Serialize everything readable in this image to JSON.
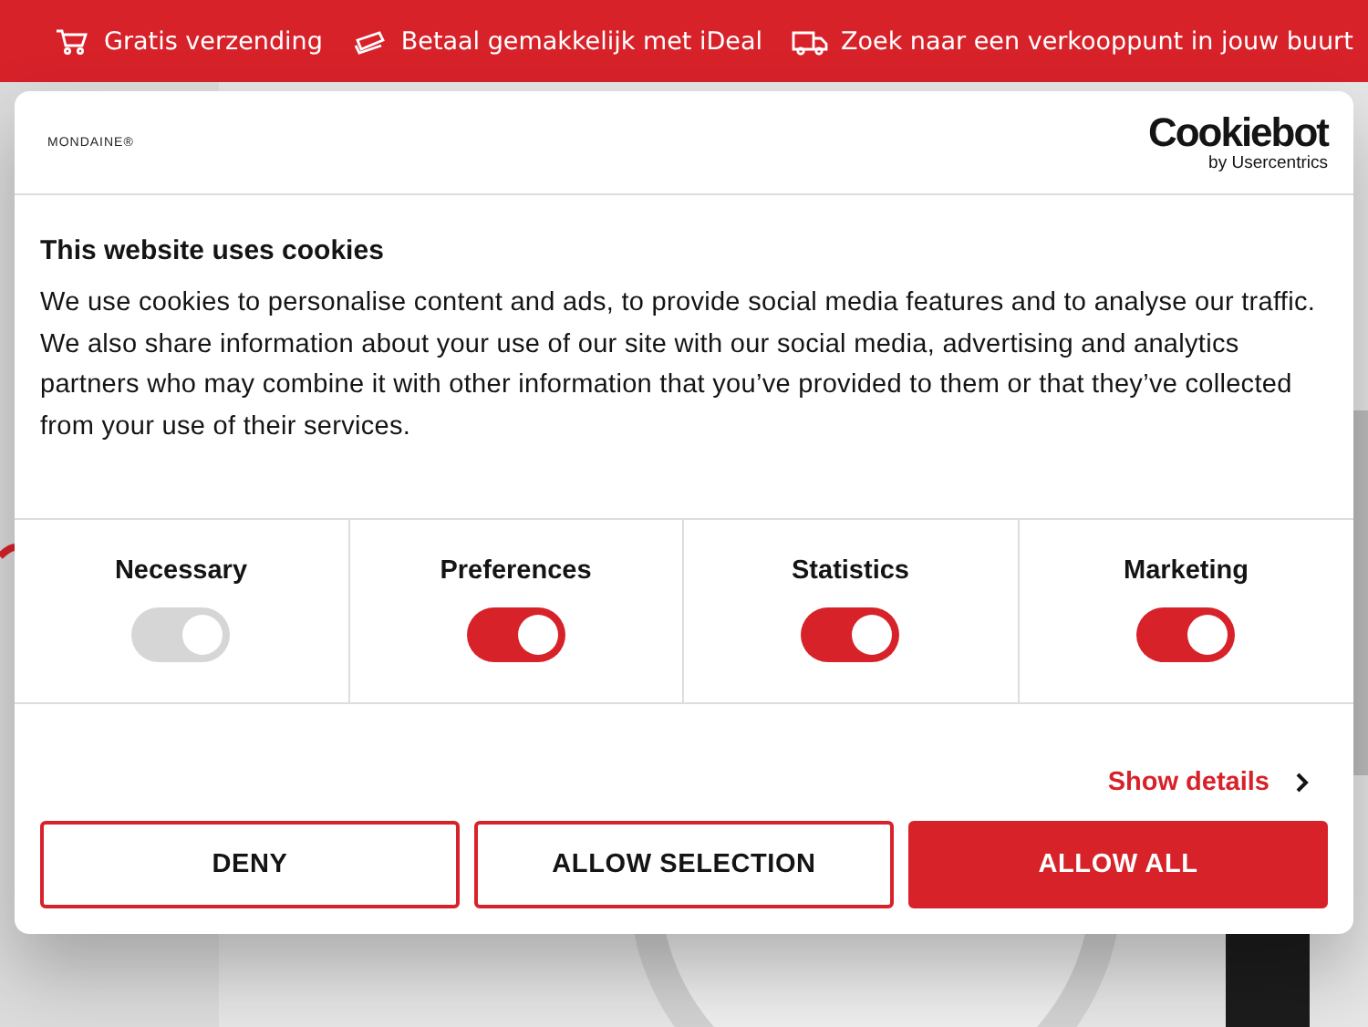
{
  "promo_bar": [
    {
      "kind": "cart",
      "text": "Gratis verzending"
    },
    {
      "kind": "money",
      "text": "Betaal gemakkelijk met iDeal"
    },
    {
      "kind": "truck",
      "text": "Zoek naar een verkooppunt in jouw buurt"
    }
  ],
  "dialog": {
    "brand_logo": "MONDAINE®",
    "provider_logo": {
      "name": "Cookiebot",
      "byline": "by Usercentrics"
    },
    "title": "This website uses cookies",
    "body": "We use cookies to personalise content and ads, to provide social media features and to analyse our traffic. We also share information about your use of our site with our social media, advertising and analytics partners who may combine it with other information that you’ve provided to them or that they’ve collected from your use of their services.",
    "categories": [
      {
        "label": "Necessary",
        "checked": true,
        "disabled": true
      },
      {
        "label": "Preferences",
        "checked": true,
        "disabled": false
      },
      {
        "label": "Statistics",
        "checked": true,
        "disabled": false
      },
      {
        "label": "Marketing",
        "checked": true,
        "disabled": false
      }
    ],
    "details_link": "Show details",
    "buttons": [
      {
        "label": "DENY",
        "kind": "outline"
      },
      {
        "label": "ALLOW SELECTION",
        "kind": "outline"
      },
      {
        "label": "ALLOW ALL",
        "kind": "solid"
      }
    ]
  }
}
